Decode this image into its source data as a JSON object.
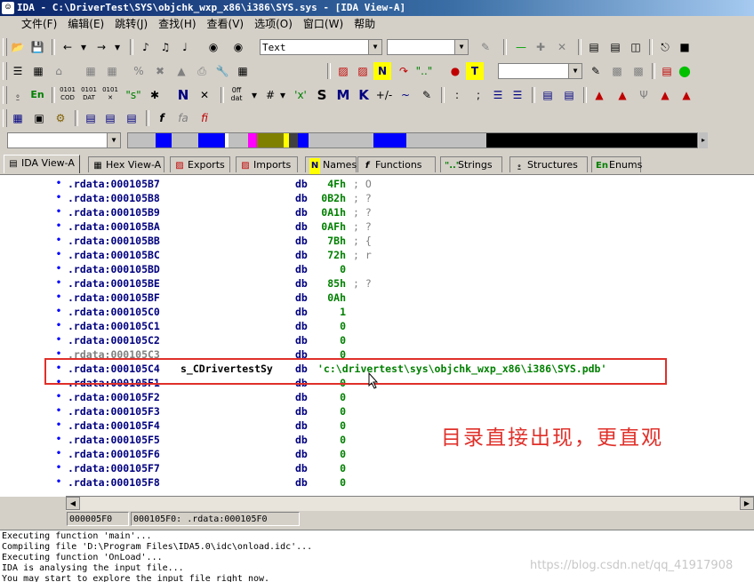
{
  "window": {
    "title": "IDA - C:\\DriverTest\\SYS\\objchk_wxp_x86\\i386\\SYS.sys - [IDA View-A]"
  },
  "menu": [
    "文件(F)",
    "编辑(E)",
    "跳转(J)",
    "查找(H)",
    "查看(V)",
    "选项(O)",
    "窗口(W)",
    "帮助"
  ],
  "toolbar": {
    "font_combo": "Text",
    "en_label": "En"
  },
  "tabs": [
    {
      "label": "IDA View-A",
      "icon": "ida-view-icon"
    },
    {
      "label": "Hex View-A",
      "icon": "hex-view-icon"
    },
    {
      "label": "Exports",
      "icon": "exports-icon"
    },
    {
      "label": "Imports",
      "icon": "imports-icon"
    },
    {
      "label": "Names",
      "icon": "names-icon"
    },
    {
      "label": "Functions",
      "icon": "functions-icon"
    },
    {
      "label": "Strings",
      "icon": "strings-icon"
    },
    {
      "label": "Structures",
      "icon": "structures-icon"
    },
    {
      "label": "Enums",
      "icon": "enums-icon"
    }
  ],
  "listing": [
    {
      "addr": ".rdata:000105B7",
      "label": "",
      "mnem": "db",
      "op": "4Fh",
      "cmt": "; O"
    },
    {
      "addr": ".rdata:000105B8",
      "label": "",
      "mnem": "db",
      "op": "0B2h",
      "cmt": "; ?"
    },
    {
      "addr": ".rdata:000105B9",
      "label": "",
      "mnem": "db",
      "op": "0A1h",
      "cmt": "; ?"
    },
    {
      "addr": ".rdata:000105BA",
      "label": "",
      "mnem": "db",
      "op": "0AFh",
      "cmt": "; ?"
    },
    {
      "addr": ".rdata:000105BB",
      "label": "",
      "mnem": "db",
      "op": "7Bh",
      "cmt": "; {"
    },
    {
      "addr": ".rdata:000105BC",
      "label": "",
      "mnem": "db",
      "op": "72h",
      "cmt": "; r"
    },
    {
      "addr": ".rdata:000105BD",
      "label": "",
      "mnem": "db",
      "op": "0",
      "cmt": ""
    },
    {
      "addr": ".rdata:000105BE",
      "label": "",
      "mnem": "db",
      "op": "85h",
      "cmt": "; ?"
    },
    {
      "addr": ".rdata:000105BF",
      "label": "",
      "mnem": "db",
      "op": "0Ah",
      "cmt": ""
    },
    {
      "addr": ".rdata:000105C0",
      "label": "",
      "mnem": "db",
      "op": "1",
      "cmt": ""
    },
    {
      "addr": ".rdata:000105C1",
      "label": "",
      "mnem": "db",
      "op": "0",
      "cmt": ""
    },
    {
      "addr": ".rdata:000105C2",
      "label": "",
      "mnem": "db",
      "op": "0",
      "cmt": ""
    },
    {
      "addr": ".rdata:000105C3",
      "label": "",
      "mnem": "db",
      "op": "0",
      "cmt": ""
    },
    {
      "addr": ".rdata:000105C4",
      "label": "s_CDrivertestSy",
      "mnem": "db",
      "op": "'c:\\drivertest\\sys\\objchk_wxp_x86\\i386\\SYS.pdb'",
      "cmt": "",
      "string": true
    },
    {
      "addr": ".rdata:000105F1",
      "label": "",
      "mnem": "db",
      "op": "0",
      "cmt": ""
    },
    {
      "addr": ".rdata:000105F2",
      "label": "",
      "mnem": "db",
      "op": "0",
      "cmt": ""
    },
    {
      "addr": ".rdata:000105F3",
      "label": "",
      "mnem": "db",
      "op": "0",
      "cmt": ""
    },
    {
      "addr": ".rdata:000105F4",
      "label": "",
      "mnem": "db",
      "op": "0",
      "cmt": ""
    },
    {
      "addr": ".rdata:000105F5",
      "label": "",
      "mnem": "db",
      "op": "0",
      "cmt": ""
    },
    {
      "addr": ".rdata:000105F6",
      "label": "",
      "mnem": "db",
      "op": "0",
      "cmt": ""
    },
    {
      "addr": ".rdata:000105F7",
      "label": "",
      "mnem": "db",
      "op": "0",
      "cmt": ""
    },
    {
      "addr": ".rdata:000105F8",
      "label": "",
      "mnem": "db",
      "op": "0",
      "cmt": ""
    }
  ],
  "annotation": "目录直接出现，更直观",
  "status": {
    "offset": "000005F0",
    "location": "000105F0: .rdata:000105F0"
  },
  "output": [
    "Executing function 'main'...",
    "Compiling file 'D:\\Program Files\\IDA5.0\\idc\\onload.idc'...",
    "Executing function 'OnLoad'...",
    "IDA is analysing the input file...",
    "You may start to explore the input file right now."
  ],
  "watermark": "https://blog.csdn.net/qq_41917908",
  "colors": {
    "highlight_box": "#e0302a",
    "address": "#000080",
    "operand": "#008000"
  }
}
